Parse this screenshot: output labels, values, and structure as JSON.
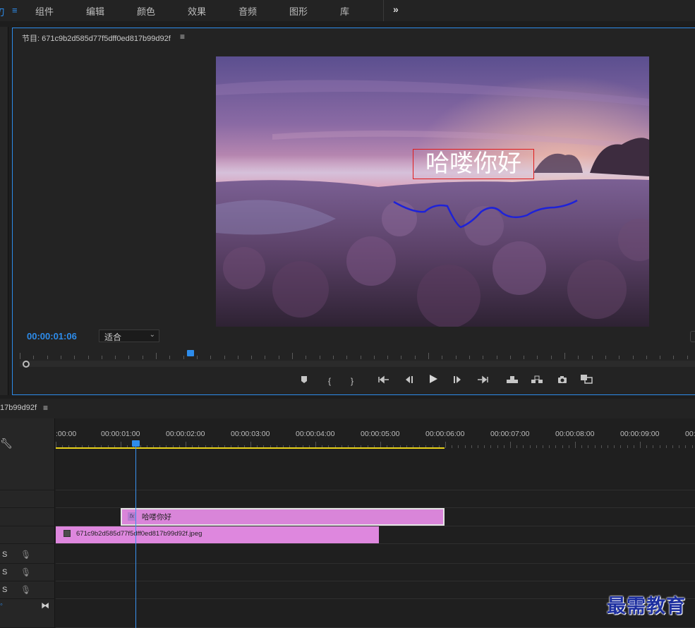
{
  "menubar": {
    "edge_glyph": "ิ๋",
    "edge_glyph_alt": "刃",
    "hamburger": "≡",
    "items": [
      "组件",
      "编辑",
      "颜色",
      "效果",
      "音频",
      "图形",
      "库"
    ],
    "more": "»"
  },
  "monitor": {
    "title": "节目: 671c9b2d585d77f5dff0ed817b99d92f",
    "menu_glyph": "≡",
    "title_overlay": "哈喽你好",
    "timecode": "00:00:01:06",
    "zoom": "适合"
  },
  "timeline": {
    "sequence_name": "17b99d92f",
    "menu_glyph": "≡",
    "times": [
      ":00:00",
      "00:00:01:00",
      "00:00:02:00",
      "00:00:03:00",
      "00:00:04:00",
      "00:00:05:00",
      "00:00:06:00",
      "00:00:07:00",
      "00:00:08:00",
      "00:00:09:00",
      "00:0"
    ],
    "clip_title_name": "哈喽你好",
    "clip_title_fx": "fx",
    "clip_image_name": "671c9b2d585d77f5dff0ed817b99d92f.jpeg",
    "audio_tracks": [
      "S",
      "S",
      "S"
    ]
  },
  "watermark": "最需教育",
  "colors": {
    "accent": "#2d8ceb",
    "clip": "#de87de",
    "workarea": "#e8d21a",
    "title_box": "#e01b1b",
    "curve": "#1e22d8"
  }
}
